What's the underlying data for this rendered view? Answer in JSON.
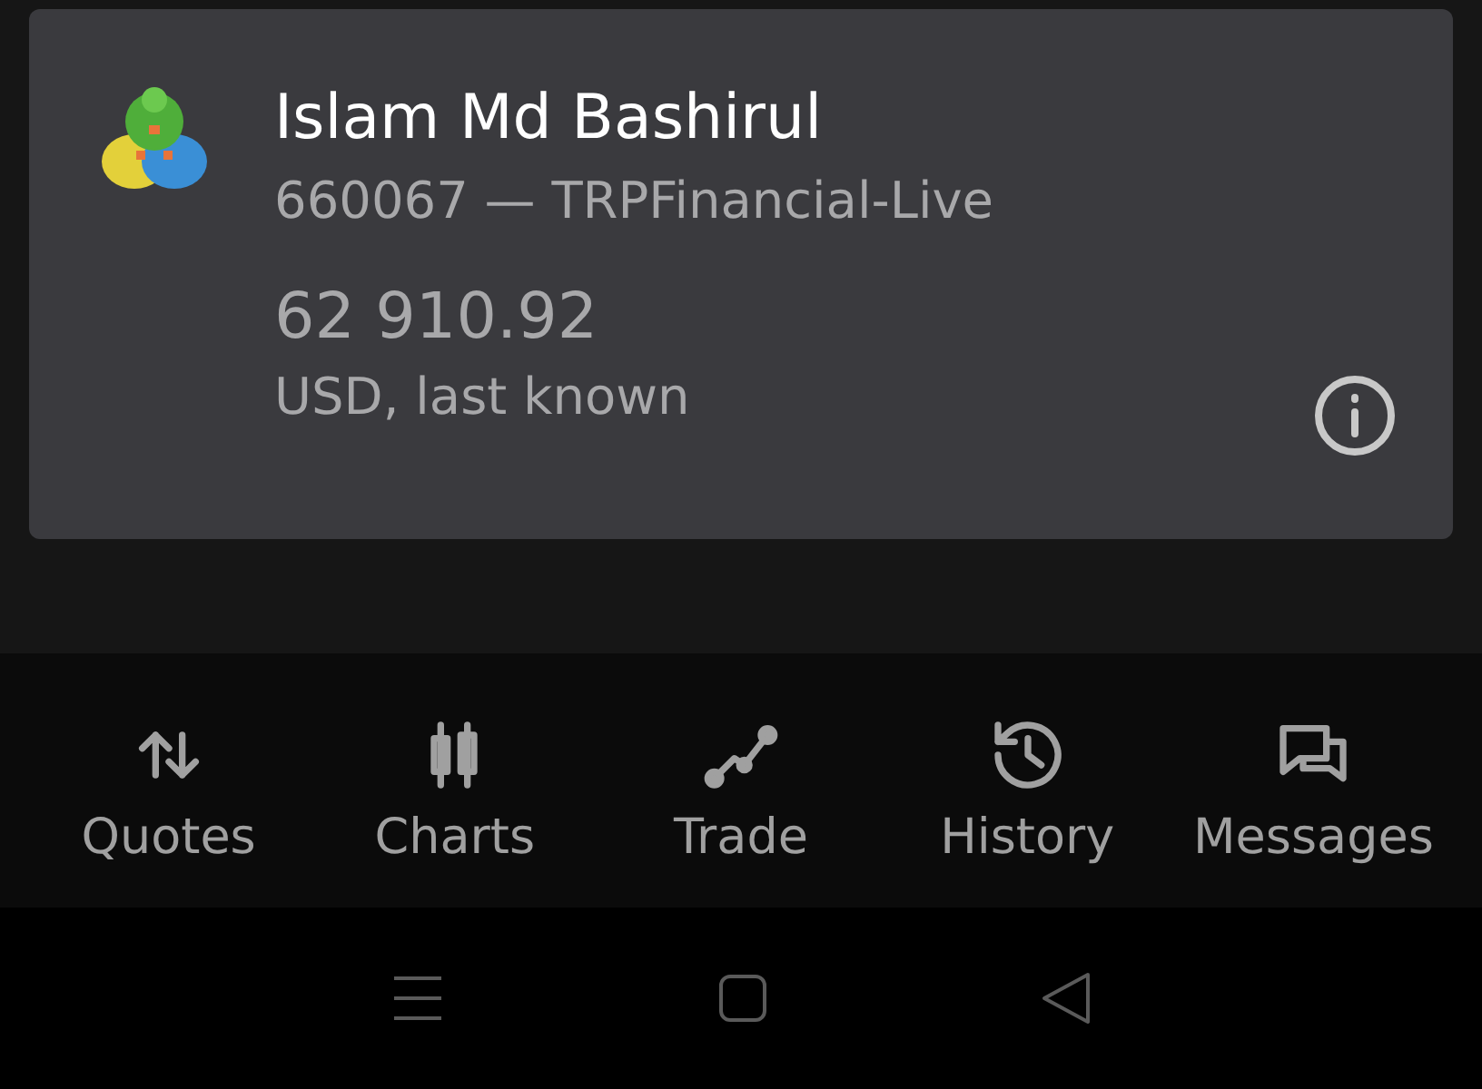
{
  "account_card": {
    "name": "Islam Md Bashirul",
    "account": "660067 — TRPFinancial-Live",
    "balance": "62 910.92",
    "balance_note": "USD, last known"
  },
  "bottom_nav": [
    {
      "kind": "quotes",
      "label": "Quotes"
    },
    {
      "kind": "charts",
      "label": "Charts"
    },
    {
      "kind": "trade",
      "label": "Trade"
    },
    {
      "kind": "history",
      "label": "History"
    },
    {
      "kind": "messages",
      "label": "Messages"
    }
  ]
}
